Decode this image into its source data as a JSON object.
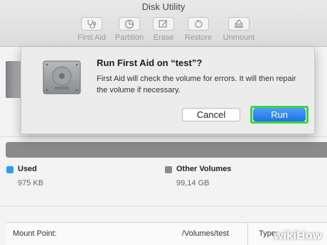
{
  "window": {
    "title": "Disk Utility"
  },
  "toolbar": {
    "items": [
      {
        "label": "First Aid",
        "icon": "stethoscope-icon"
      },
      {
        "label": "Partition",
        "icon": "pie-icon"
      },
      {
        "label": "Erase",
        "icon": "eraser-icon"
      },
      {
        "label": "Restore",
        "icon": "restore-arrow-icon"
      },
      {
        "label": "Unmount",
        "icon": "eject-icon"
      }
    ]
  },
  "dialog": {
    "title": "Run First Aid on “test”?",
    "message": "First Aid will check the volume for errors. It will then repair the volume if necessary.",
    "cancel_label": "Cancel",
    "run_label": "Run",
    "run_highlight_color": "#3dd639"
  },
  "usage": {
    "used": {
      "label": "Used",
      "value": "975 KB",
      "color": "#2a9df4"
    },
    "other": {
      "label": "Other Volumes",
      "value": "99,14 GB",
      "color": "#8a8a8a"
    }
  },
  "info": {
    "mount_point_label": "Mount Point:",
    "mount_point_value": "/Volumes/test",
    "type_label": "Type:"
  },
  "watermark": {
    "wiki": "wiki",
    "how": "How"
  }
}
